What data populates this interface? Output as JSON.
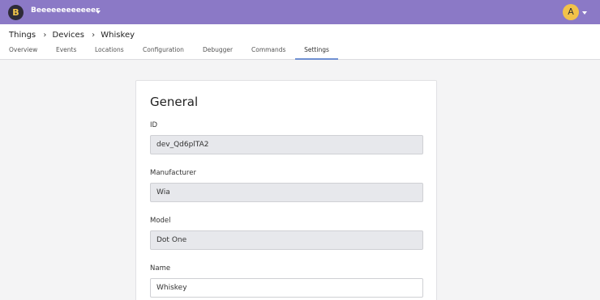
{
  "topbar": {
    "org_initial": "B",
    "org_name": "Beeeeeeeeeeeer",
    "user_initial": "A"
  },
  "breadcrumb": [
    "Things",
    "Devices",
    "Whiskey"
  ],
  "breadcrumb_separator": "›",
  "tabs": [
    "Overview",
    "Events",
    "Locations",
    "Configuration",
    "Debugger",
    "Commands",
    "Settings"
  ],
  "active_tab": "Settings",
  "card": {
    "title": "General",
    "fields": [
      {
        "label": "ID",
        "value": "dev_Qd6plTA2",
        "readonly": true
      },
      {
        "label": "Manufacturer",
        "value": "Wia",
        "readonly": true
      },
      {
        "label": "Model",
        "value": "Dot One",
        "readonly": true
      },
      {
        "label": "Name",
        "value": "Whiskey",
        "readonly": false
      }
    ]
  },
  "colors": {
    "topbar": "#8b79c6",
    "active_tab_underline": "#6f8fd2"
  }
}
